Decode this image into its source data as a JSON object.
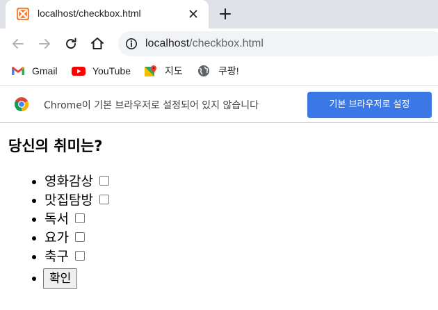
{
  "tab": {
    "title": "localhost/checkbox.html",
    "favicon": "xampp-icon",
    "close_icon": "close-icon",
    "new_tab_icon": "plus-icon"
  },
  "toolbar": {
    "back_icon": "back-arrow-icon",
    "forward_icon": "forward-arrow-icon",
    "reload_icon": "reload-icon",
    "home_icon": "home-icon",
    "info_icon": "info-icon",
    "url_host": "localhost",
    "url_path": "/checkbox.html"
  },
  "bookmarks": [
    {
      "label": "Gmail",
      "icon": "gmail-icon"
    },
    {
      "label": "YouTube",
      "icon": "youtube-icon"
    },
    {
      "label": "지도",
      "icon": "maps-icon"
    },
    {
      "label": "쿠팡!",
      "icon": "globe-icon"
    }
  ],
  "infobar": {
    "message": "Chrome이 기본 브라우저로 설정되어 있지 않습니다",
    "button_label": "기본 브라우저로 설정"
  },
  "page": {
    "heading": "당신의 취미는?",
    "hobbies": [
      {
        "label": "영화감상",
        "checked": false
      },
      {
        "label": "맛집탐방",
        "checked": false
      },
      {
        "label": "독서",
        "checked": false
      },
      {
        "label": "요가",
        "checked": false
      },
      {
        "label": "축구",
        "checked": false
      }
    ],
    "confirm_label": "확인"
  },
  "colors": {
    "tabstrip_bg": "#dee1e6",
    "omnibox_bg": "#f1f3f4",
    "infobar_button": "#3c78e5",
    "favicon": "#f57c31"
  }
}
